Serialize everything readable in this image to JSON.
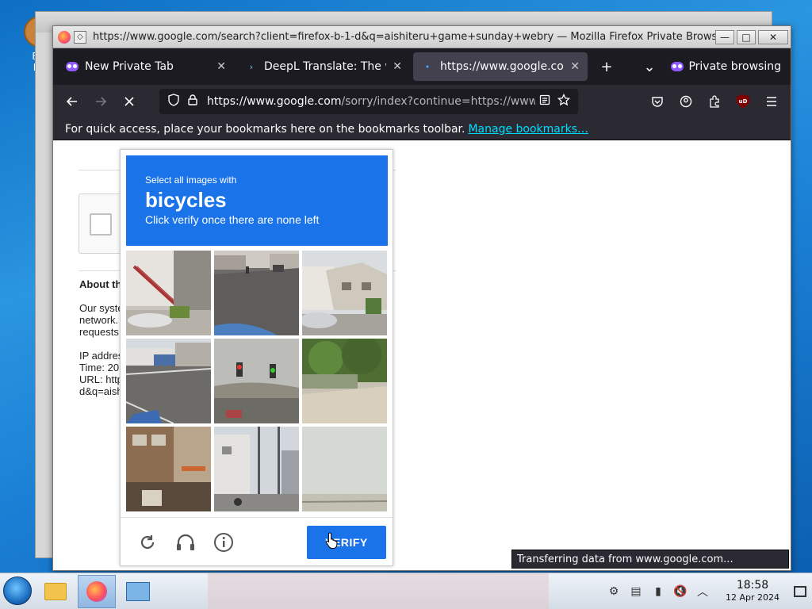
{
  "desktop": {
    "icon_label_1": "Big",
    "icon_label_2": "De"
  },
  "window": {
    "title": "https://www.google.com/search?client=firefox-b-1-d&q=aishiteru+game+sunday+webry — Mozilla Firefox Private Browsing",
    "minimize": "—",
    "maximize": "□",
    "close": "✕"
  },
  "tabs": [
    {
      "label": "New Private Tab",
      "icon": "private-mask-icon"
    },
    {
      "label": "DeepL Translate: The wo",
      "icon": "deepl-icon"
    },
    {
      "label": "https://www.google.com/",
      "icon": "loading-icon",
      "active": true
    }
  ],
  "tabbar": {
    "new_tab": "+",
    "list_tabs": "⌄",
    "private_label": "Private browsing"
  },
  "navbar": {
    "url_host": "https://www.google.com",
    "url_rest": "/sorry/index?continue=https://www.g"
  },
  "bookmarks": {
    "hint": "For quick access, place your bookmarks here on the bookmarks toolbar.",
    "manage_link": "Manage bookmarks…"
  },
  "page": {
    "about_heading": "About th",
    "about_line1": "Our syste",
    "about_line2": "network.",
    "about_line3": "requests",
    "ip_line": "IP addres",
    "time_line": "Time: 20",
    "url_line": "URL: http",
    "url_line2": "d&q=aish"
  },
  "captcha": {
    "instruction": "Select all images with",
    "target": "bicycles",
    "subtext": "Click verify once there are none left",
    "verify_label": "VERIFY",
    "tiles": [
      "street-stairs",
      "road-motorbike",
      "houses-car",
      "parking-lot",
      "traffic-lights",
      "bushes-fence",
      "shop-building",
      "street-poles",
      "foggy-field"
    ]
  },
  "status": {
    "text": "Transferring data from www.google.com..."
  },
  "taskbar": {
    "time": "18:58",
    "date": "12 Apr 2024"
  },
  "colors": {
    "captcha_blue": "#1a73e8",
    "firefox_dark": "#1c1b22",
    "toolbar": "#2b2a33",
    "link": "#00ddff"
  }
}
